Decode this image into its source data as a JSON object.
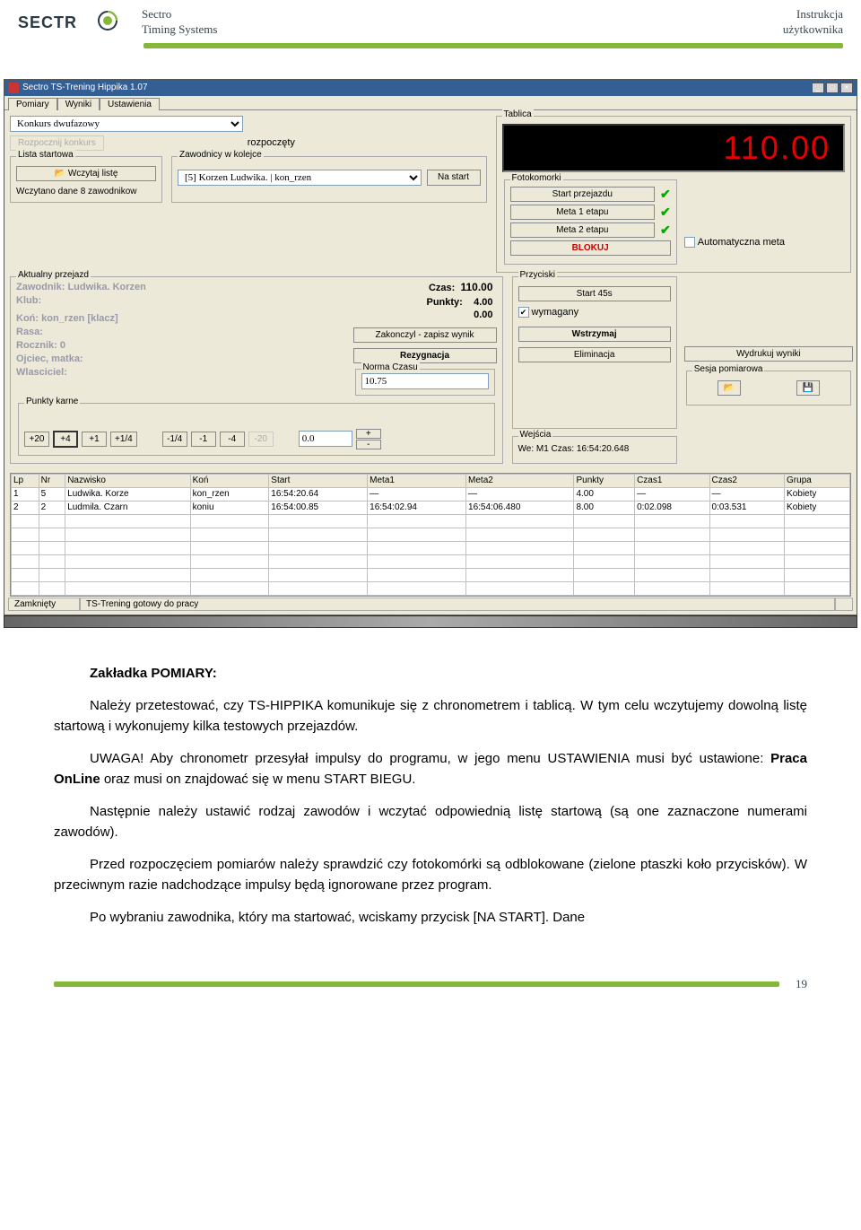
{
  "doc_header": {
    "brand_upper": "Sectro",
    "brand_lower": "Timing Systems",
    "right_upper": "Instrukcja",
    "right_lower": "użytkownika"
  },
  "win": {
    "title": "Sectro TS-Trening Hippika 1.07",
    "tabs": [
      "Pomiary",
      "Wyniki",
      "Ustawienia"
    ],
    "konkurs_select": "Konkurs dwufazowy",
    "rozpocznij": "Rozpocznij konkurs",
    "status_rozp": "rozpoczęty",
    "lista_startowa": {
      "legend": "Lista startowa",
      "wczytaj": "Wczytaj listę",
      "loaded_msg": "Wczytano dane 8 zawodnikow"
    },
    "kolejka": {
      "legend": "Zawodnicy w kolejce",
      "select": "[5] Korzen Ludwika. | kon_rzen",
      "nastart": "Na start"
    },
    "tablica": "Tablica",
    "display": "110.00",
    "fotokomorki": {
      "legend": "Fotokomorki",
      "start": "Start przejazdu",
      "meta1": "Meta 1 etapu",
      "meta2": "Meta 2 etapu",
      "blokuj": "BLOKUJ"
    },
    "aktualny": {
      "legend": "Aktualny przejazd",
      "zawodnik_lbl": "Zawodnik:",
      "zawodnik": "Ludwika. Korzen",
      "klub_lbl": "Klub:",
      "kon_lbl": "Koń:",
      "kon": "kon_rzen [klacz]",
      "rasa_lbl": "Rasa:",
      "rocznik_lbl": "Rocznik: 0",
      "ojciec_lbl": "Ojciec, matka:",
      "wlasciciel_lbl": "Wlasciciel:",
      "czas_lbl": "Czas:",
      "czas": "110.00",
      "punkty_lbl": "Punkty:",
      "punkty1": "4.00",
      "punkty2": "0.00",
      "zakoncz": "Zakonczyl - zapisz wynik",
      "rezygnacja": "Rezygnacja"
    },
    "norma": {
      "legend": "Norma Czasu",
      "value": "10.75"
    },
    "karne": {
      "legend": "Punkty karne",
      "buttons": [
        "+20",
        "+4",
        "+1",
        "+1/4",
        "-1/4",
        "-1",
        "-4",
        "-20"
      ],
      "value": "0.0",
      "plus": "+",
      "minus": "-"
    },
    "przyciski": {
      "legend": "Przyciski",
      "start45": "Start 45s",
      "wymagany": "wymagany",
      "wstrzymaj": "Wstrzymaj",
      "eliminacja": "Eliminacja"
    },
    "automatyczna": "Automatyczna meta",
    "wydrukuj": "Wydrukuj wyniki",
    "sesja": "Sesja pomiarowa",
    "wejscia": {
      "legend": "Wejścia",
      "text": "We: M1   Czas: 16:54:20.648"
    }
  },
  "table": {
    "headers": [
      "Lp",
      "Nr",
      "Nazwisko",
      "Koń",
      "Start",
      "Meta1",
      "Meta2",
      "Punkty",
      "Czas1",
      "Czas2",
      "Grupa"
    ],
    "rows": [
      [
        "1",
        "5",
        "Ludwika. Korze",
        "kon_rzen",
        "16:54:20.64",
        "—",
        "—",
        "4.00",
        "—",
        "—",
        "Kobiety"
      ],
      [
        "2",
        "2",
        "Ludmila. Czarn",
        "koniu",
        "16:54:00.85",
        "16:54:02.94",
        "16:54:06.480",
        "8.00",
        "0:02.098",
        "0:03.531",
        "Kobiety"
      ]
    ],
    "status_left": "Zamknięty",
    "status_right": "TS-Trening gotowy do pracy"
  },
  "body": {
    "h": "Zakładka POMIARY:",
    "p1": "Należy przetestować, czy TS-HIPPIKA komunikuje się z chronometrem i tablicą. W tym celu wczytujemy dowolną listę startową i wykonujemy kilka testowych przejazdów.",
    "p2a": "UWAGA! Aby chronometr przesyłał impulsy do programu, w jego menu USTAWIENIA musi być ustawione: ",
    "p2b": "Praca OnLine",
    "p2c": " oraz musi on znajdować się w menu START BIEGU.",
    "p3": "Następnie należy ustawić rodzaj zawodów i wczytać odpowiednią listę startową (są one zaznaczone numerami zawodów).",
    "p4": "Przed rozpoczęciem pomiarów należy sprawdzić czy fotokomórki są odblokowane (zielone ptaszki koło przycisków). W przeciwnym razie nadchodzące impulsy będą ignorowane przez program.",
    "p5": "Po wybraniu zawodnika, który ma startować, wciskamy przycisk [NA START]. Dane"
  },
  "page_num": "19"
}
